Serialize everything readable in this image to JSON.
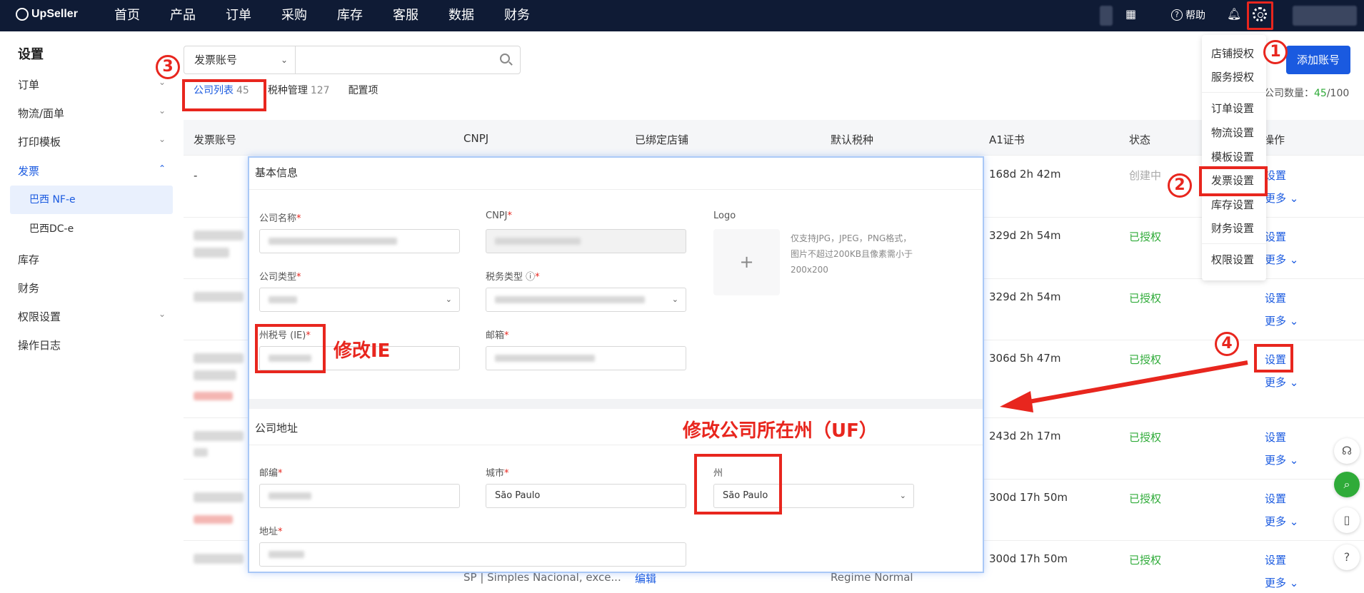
{
  "topbar": {
    "brand": "UpSeller",
    "nav": [
      "首页",
      "产品",
      "订单",
      "采购",
      "库存",
      "客服",
      "数据",
      "财务"
    ],
    "help_label": "帮助"
  },
  "sidebar": {
    "title": "设置",
    "items": [
      {
        "label": "订单",
        "chevron": "down"
      },
      {
        "label": "物流/面单",
        "chevron": "down"
      },
      {
        "label": "打印模板",
        "chevron": "down"
      },
      {
        "label": "发票",
        "chevron": "up",
        "active": true
      },
      {
        "label": "库存"
      },
      {
        "label": "财务"
      },
      {
        "label": "权限设置",
        "chevron": "down"
      },
      {
        "label": "操作日志"
      }
    ],
    "sub_items": [
      "巴西 NF-e",
      "巴西DC-e"
    ]
  },
  "filter": {
    "select_value": "发票账号",
    "search_value": ""
  },
  "tabs": [
    {
      "label": "公司列表",
      "count": "45"
    },
    {
      "label": "税种管理",
      "count": "127"
    },
    {
      "label": "配置项",
      "count": ""
    }
  ],
  "add_button": "添加账号",
  "company_count": {
    "label": "公司数量：",
    "used": "45",
    "total": "/100"
  },
  "table": {
    "headers": [
      "发票账号",
      "CNPJ",
      "已绑定店铺",
      "默认税种",
      "A1证书",
      "状态",
      "操作"
    ],
    "rows": [
      {
        "account": "-",
        "cert": "168d 2h 42m",
        "status": "创建中",
        "status_type": "pending",
        "action": "设置",
        "more": "更多"
      },
      {
        "account": "",
        "cert": "329d 2h 54m",
        "status": "已授权",
        "status_type": "ok",
        "action": "设置",
        "more": "更多"
      },
      {
        "account": "",
        "cert": "329d 2h 54m",
        "status": "已授权",
        "status_type": "ok",
        "action": "设置",
        "more": "更多"
      },
      {
        "account": "",
        "cert": "306d 5h 47m",
        "status": "已授权",
        "status_type": "ok",
        "action": "设置",
        "more": "更多"
      },
      {
        "account": "",
        "cert": "243d 2h 17m",
        "status": "已授权",
        "status_type": "ok",
        "action": "设置",
        "more": "更多"
      },
      {
        "account": "",
        "cert": "300d 17h 50m",
        "status": "已授权",
        "status_type": "ok",
        "action": "设置",
        "more": "更多"
      },
      {
        "account": "",
        "cert": "300d 17h 50m",
        "status": "已授权",
        "status_type": "ok",
        "action": "设置",
        "more": "更多",
        "cnpj_tax": "SP | Simples Nacional, exce...",
        "edit": "编辑",
        "default_tax": "Regime Normal"
      }
    ]
  },
  "settings_menu": {
    "groups": [
      [
        "店铺授权",
        "服务授权"
      ],
      [
        "订单设置",
        "物流设置",
        "模板设置",
        "发票设置",
        "库存设置",
        "财务设置"
      ],
      [
        "权限设置"
      ]
    ]
  },
  "markers": [
    "1",
    "2",
    "3",
    "4"
  ],
  "overlay": {
    "basic_title": "基本信息",
    "company_name_label": "公司名称",
    "cnpj_label": "CNPJ",
    "logo_label": "Logo",
    "logo_plus": "+",
    "logo_hint": "仅支持JPG，JPEG，PNG格式，图片不超过200KB且像素需小于 200x200",
    "company_type_label": "公司类型",
    "tax_type_label": "税务类型",
    "ie_label": "州税号 (IE)",
    "email_label": "邮箱",
    "address_title": "公司地址",
    "zip_label": "邮编",
    "city_label": "城市",
    "city_value": "São Paulo",
    "state_label": "州",
    "state_value": "São Paulo",
    "address_label": "地址"
  },
  "annotations": {
    "ie": "修改IE",
    "uf": "修改公司所在州（UF）"
  },
  "colors": {
    "topbar": "#0f1b35",
    "accent": "#1a5ae0",
    "annotation_red": "#e8261e",
    "status_green": "#2fab39"
  }
}
